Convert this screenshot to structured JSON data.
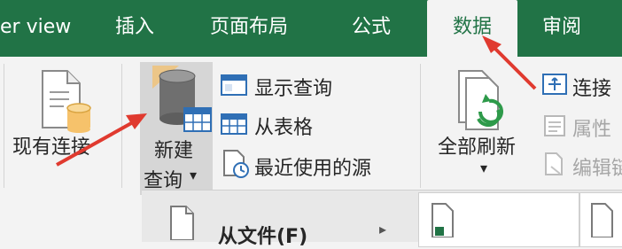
{
  "tabs": [
    {
      "label": "er view"
    },
    {
      "label": "插入"
    },
    {
      "label": "页面布局"
    },
    {
      "label": "公式"
    },
    {
      "label": "数据",
      "active": true
    },
    {
      "label": "审阅"
    }
  ],
  "ribbon": {
    "existing_connections": {
      "line1": "现有连接",
      "icon": "document-database-icon"
    },
    "new_query": {
      "line1": "新建",
      "line2": "查询",
      "dropdown": "▾",
      "icon": "database-table-icon"
    },
    "show_query": {
      "label": "显示查询",
      "icon": "window-icon"
    },
    "from_table": {
      "label": "从表格",
      "icon": "table-icon"
    },
    "recent_sources": {
      "label": "最近使用的源",
      "icon": "recent-document-icon"
    },
    "refresh_all": {
      "label": "全部刷新",
      "dropdown": "▾",
      "icon": "refresh-pages-icon"
    },
    "connections": {
      "label": "连接",
      "icon": "connection-icon"
    },
    "properties": {
      "label": "属性",
      "icon": "properties-icon"
    },
    "edit_links": {
      "label": "编辑链",
      "icon": "edit-links-icon"
    }
  },
  "dropdown_menu": {
    "from_file": {
      "label": "从文件(F)",
      "submenu_arrow": "▸",
      "icon": "file-icon"
    }
  },
  "annotations": {
    "color": "#e03a2f"
  }
}
